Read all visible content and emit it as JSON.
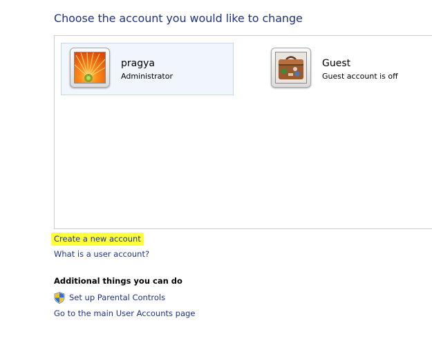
{
  "page": {
    "title": "Choose the account you would like to change"
  },
  "accounts": [
    {
      "name": "pragya",
      "role": "Administrator",
      "selected": true,
      "picture": "orange-flower"
    },
    {
      "name": "Guest",
      "role": "Guest account is off",
      "selected": false,
      "picture": "brown-briefcase"
    }
  ],
  "links": {
    "create_account": "Create a new account",
    "what_is_account": "What is a user account?"
  },
  "additional": {
    "heading": "Additional things you can do",
    "parental_controls": "Set up Parental Controls",
    "main_page": "Go to the main User Accounts page"
  },
  "colors": {
    "link": "#1e3287",
    "highlight": "#ffff3a",
    "selected_tile_bg": "#f1f6fd",
    "selected_tile_border": "#c3d6ee"
  },
  "icons": {
    "parental_controls": "shield-icon"
  }
}
